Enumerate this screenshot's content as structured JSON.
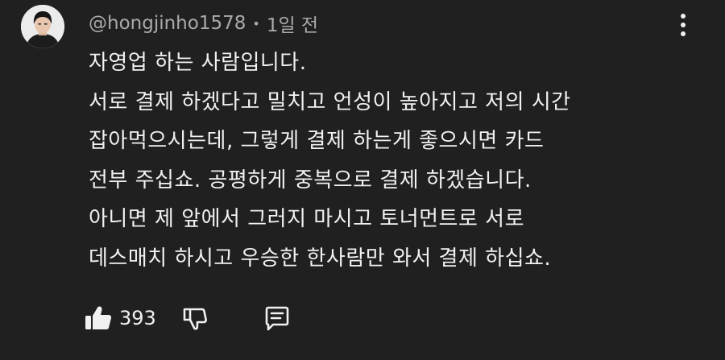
{
  "comment": {
    "author": "@hongjinho1578",
    "separator": "•",
    "timestamp": "1일 전",
    "lines": [
      "자영업 하는 사람입니다.",
      "서로 결제 하겠다고 밀치고 언성이 높아지고 저의 시간",
      "잡아먹으시는데, 그렇게 결제 하는게 좋으시면 카드",
      "전부 주십쇼. 공평하게 중복으로 결제 하겠습니다.",
      "아니면 제 앞에서 그러지 마시고 토너먼트로 서로",
      "데스매치 하시고 우승한 한사람만 와서 결제 하십쇼."
    ],
    "like_count": "393"
  },
  "icons": {
    "avatar": "avatar-photo",
    "like": "thumbs-up-icon",
    "dislike": "thumbs-down-icon",
    "reply": "reply-comment-icon",
    "more": "vertical-more-icon"
  },
  "colors": {
    "background": "#202020",
    "text_primary": "#f1f1f1",
    "text_secondary": "#aaaaaa"
  }
}
